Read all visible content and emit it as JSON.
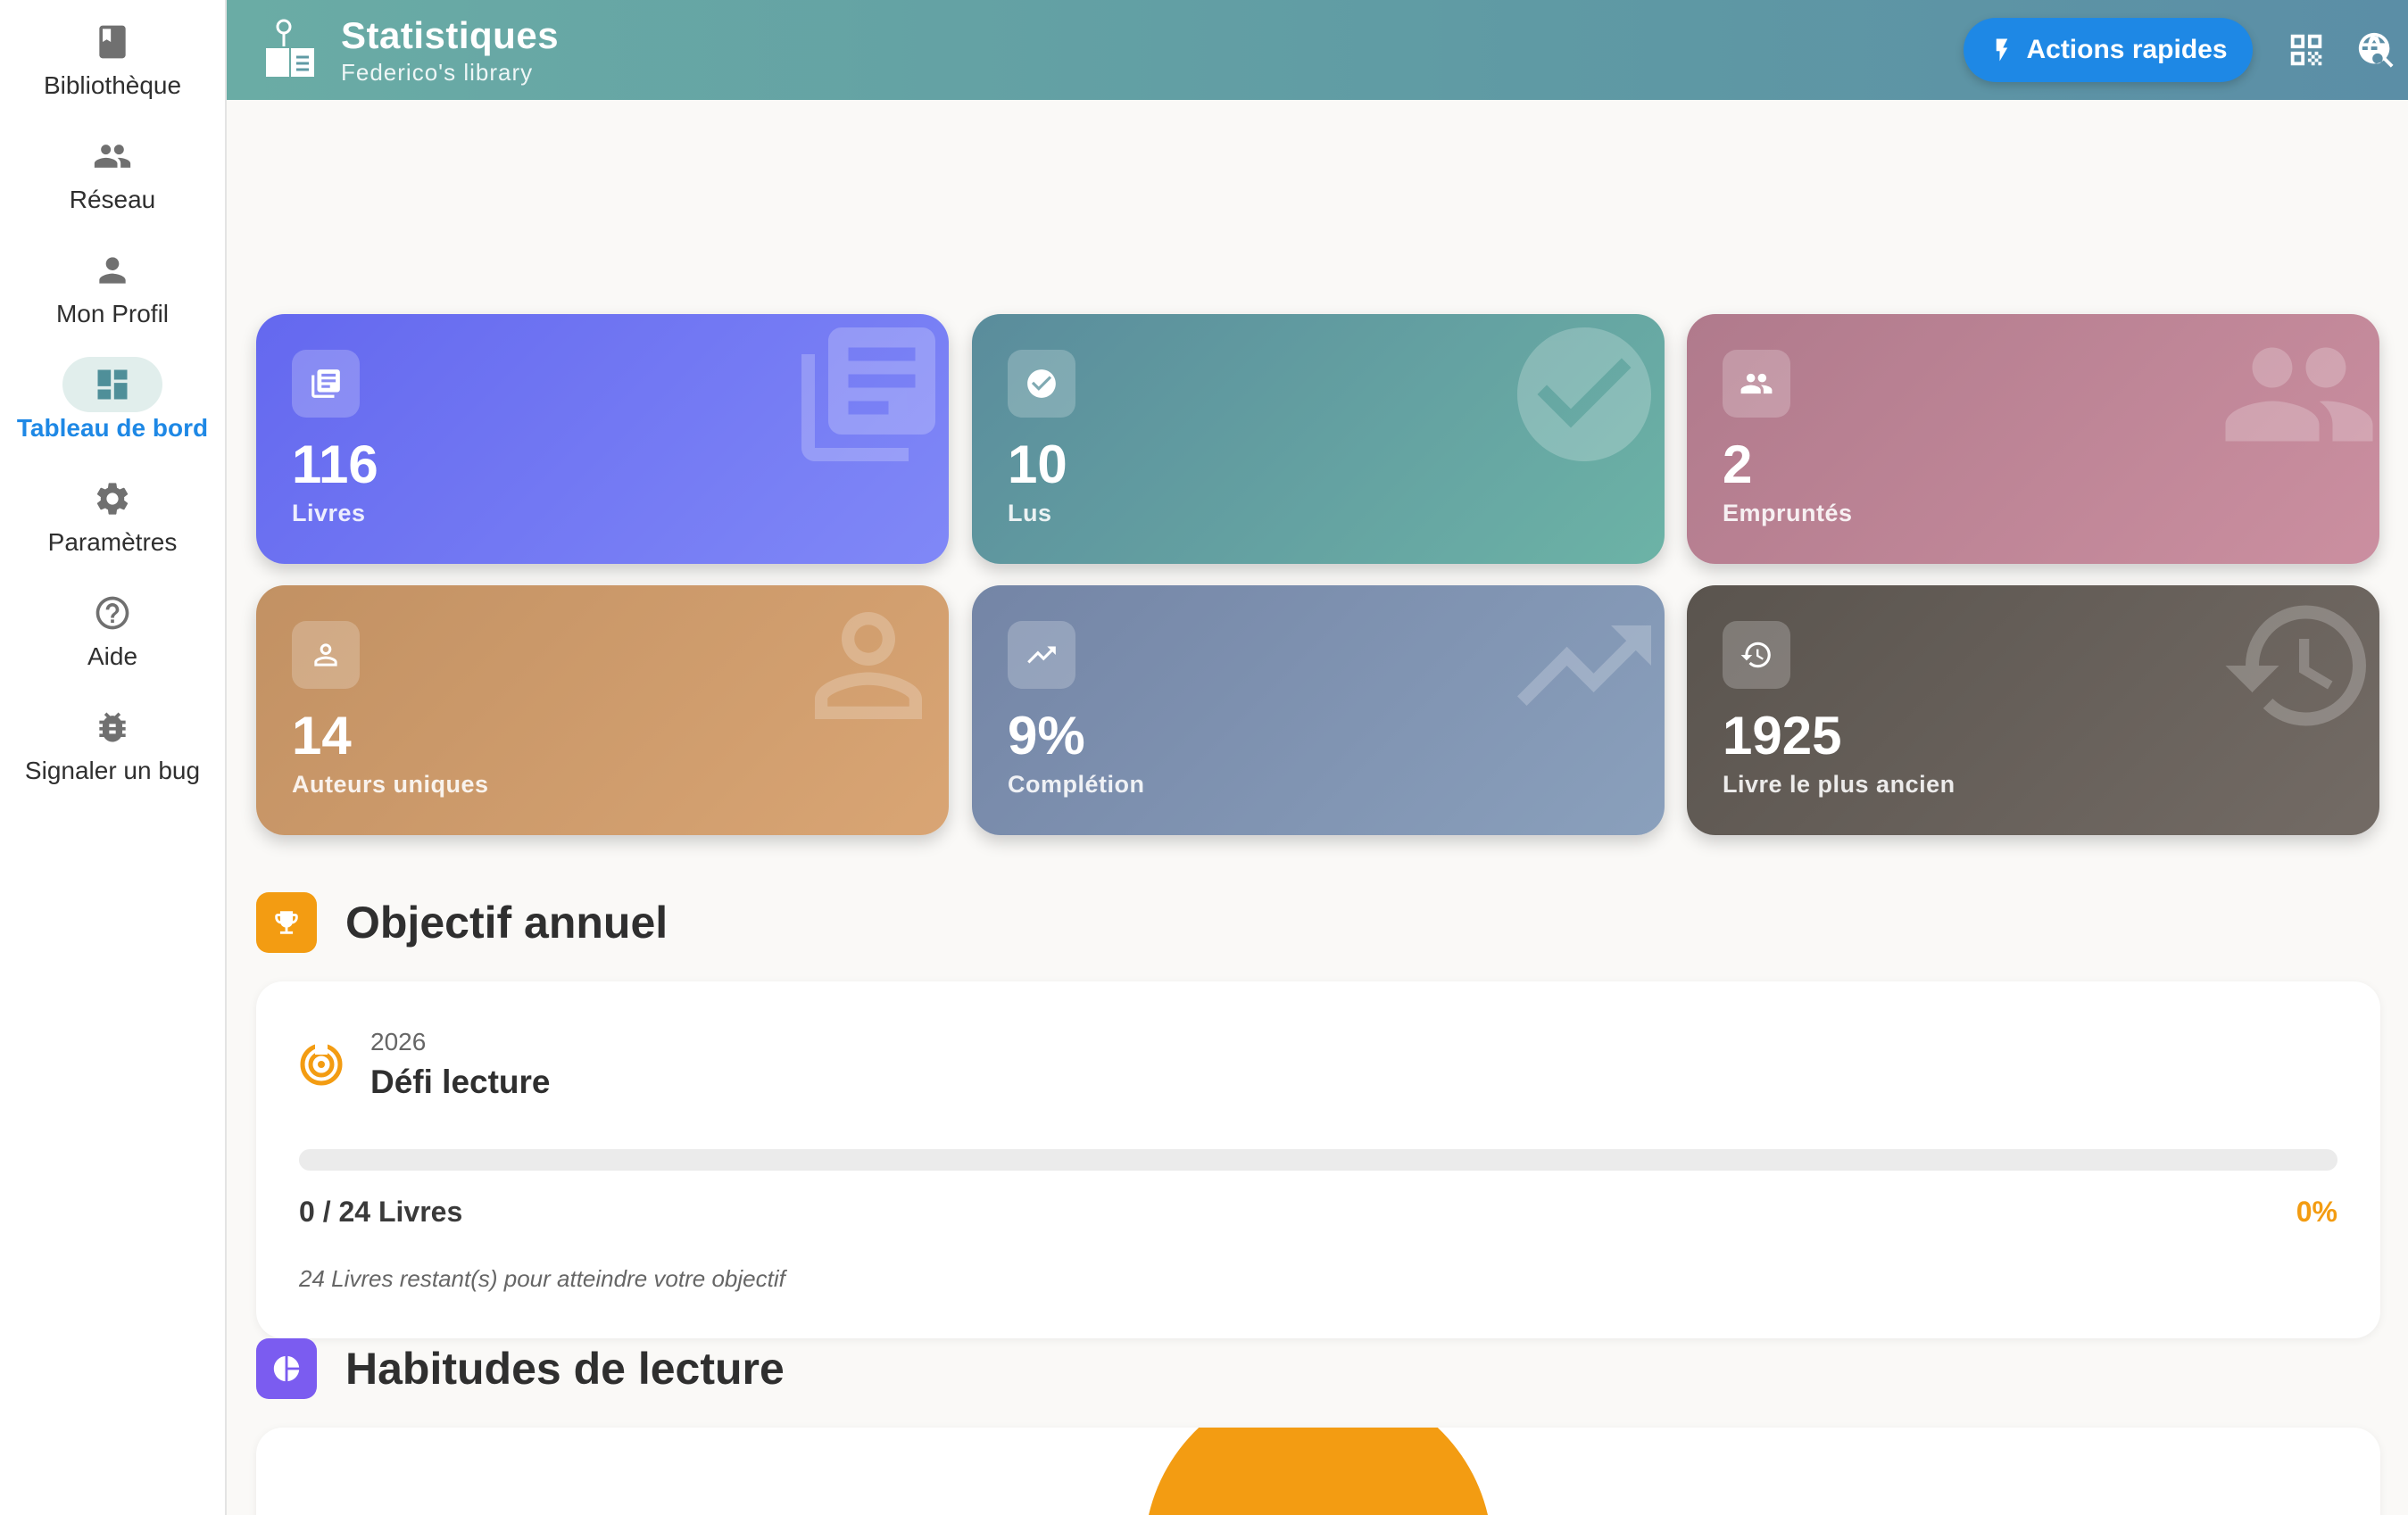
{
  "sidebar": {
    "items": [
      {
        "label": "Bibliothèque",
        "icon": "book-icon",
        "active": false
      },
      {
        "label": "Réseau",
        "icon": "group-icon",
        "active": false
      },
      {
        "label": "Mon Profil",
        "icon": "person-icon",
        "active": false
      },
      {
        "label": "Tableau de bord",
        "icon": "dashboard-icon",
        "active": true
      },
      {
        "label": "Paramètres",
        "icon": "gear-icon",
        "active": false
      },
      {
        "label": "Aide",
        "icon": "help-icon",
        "active": false
      },
      {
        "label": "Signaler un bug",
        "icon": "bug-icon",
        "active": false
      }
    ]
  },
  "header": {
    "title": "Statistiques",
    "subtitle": "Federico's library",
    "logo_icon": "reading-lamp-book-icon",
    "quick_actions_label": "Actions rapides",
    "quick_actions_icon": "lightning-icon",
    "icons": [
      "qr-scan-icon",
      "search-globe-icon"
    ]
  },
  "stats": [
    {
      "value": "116",
      "label": "Livres",
      "icon": "library-books-icon"
    },
    {
      "value": "10",
      "label": "Lus",
      "icon": "check-circle-icon"
    },
    {
      "value": "2",
      "label": "Empruntés",
      "icon": "people-icon"
    },
    {
      "value": "14",
      "label": "Auteurs uniques",
      "icon": "person-outline-icon"
    },
    {
      "value": "9%",
      "label": "Complétion",
      "icon": "trending-up-icon"
    },
    {
      "value": "1925",
      "label": "Livre le plus ancien",
      "icon": "history-icon"
    }
  ],
  "goal_section": {
    "title": "Objectif annuel",
    "icon": "trophy-icon",
    "color": "#f39c12",
    "year": "2026",
    "goal_title": "Défi lecture",
    "count_text": "0 / 24 Livres",
    "percent_text": "0%",
    "progress": 0,
    "remaining_text": "24 Livres restant(s) pour atteindre votre objectif"
  },
  "habits_section": {
    "title": "Habitudes de lecture",
    "icon": "pie-chart-icon",
    "color": "#7b5cf0",
    "chart_color": "#f39c12"
  },
  "colors": {
    "accent": "#1e88e5",
    "active_nav_bg": "#e1eeec"
  }
}
